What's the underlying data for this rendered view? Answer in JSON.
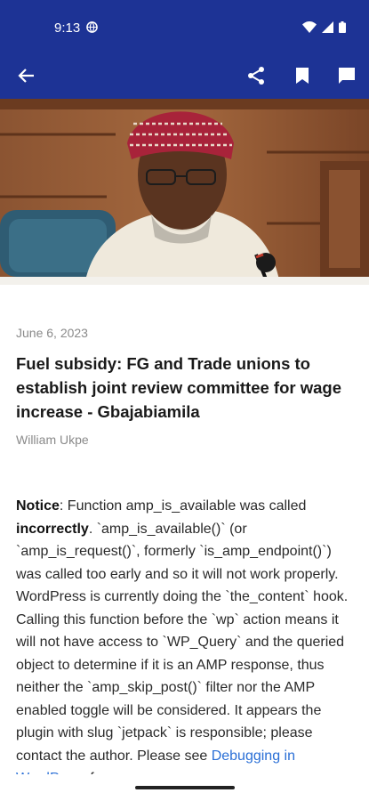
{
  "status_bar": {
    "time": "9:13",
    "icons": [
      "globe-icon",
      "wifi-icon",
      "signal-icon",
      "battery-icon"
    ]
  },
  "app_bar": {
    "background": "#1d3395",
    "icons": [
      "back-arrow-icon",
      "share-icon",
      "bookmark-icon",
      "comment-icon"
    ]
  },
  "article": {
    "date": "June 6, 2023",
    "title": "Fuel subsidy: FG and Trade unions to establish joint review committee for wage increase - Gbajabiamila",
    "author": "William Ukpe",
    "notice_label": "Notice",
    "notice_part1": ": Function amp_is_available was called ",
    "notice_bold": "incorrectly",
    "notice_part2": ". `amp_is_available()` (or `amp_is_request()`, formerly `is_amp_endpoint()`) was called too early and so it will not work properly. WordPress is currently doing the `the_content` hook. Calling this function before the `wp` action means it will not have access to `WP_Query` and the queried object to determine if it is an AMP response, thus neither the `amp_skip_post()` filter nor the AMP enabled toggle will be considered. It appears the plugin with slug `jetpack` is responsible; please contact the author. Please see ",
    "notice_link": "Debugging in WordPress",
    "notice_part3": " for"
  }
}
